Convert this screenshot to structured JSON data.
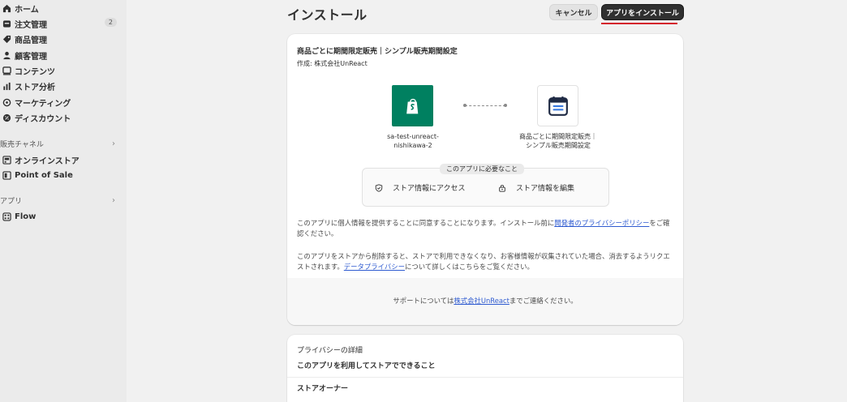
{
  "sidebar": {
    "items": [
      {
        "label": "ホーム",
        "icon": "home-icon"
      },
      {
        "label": "注文管理",
        "icon": "order-icon",
        "badge": "2"
      },
      {
        "label": "商品管理",
        "icon": "tag-icon"
      },
      {
        "label": "顧客管理",
        "icon": "person-icon"
      },
      {
        "label": "コンテンツ",
        "icon": "content-icon"
      },
      {
        "label": "ストア分析",
        "icon": "chart-icon"
      },
      {
        "label": "マーケティング",
        "icon": "target-icon"
      },
      {
        "label": "ディスカウント",
        "icon": "discount-icon"
      }
    ],
    "sales_section": "販売チャネル",
    "sales_items": [
      {
        "label": "オンラインストア",
        "icon": "store-icon"
      },
      {
        "label": "Point of Sale",
        "icon": "pos-icon"
      }
    ],
    "apps_section": "アプリ",
    "app_items": [
      {
        "label": "Flow",
        "icon": "flow-icon"
      }
    ]
  },
  "header": {
    "title": "インストール",
    "cancel_label": "キャンセル",
    "install_label": "アプリをインストール"
  },
  "card": {
    "app_title": "商品ごとに期間限定販売｜シンプル販売期間設定",
    "author": "作成: 株式会社UnReact",
    "store_name_line1": "sa-test-unreact-",
    "store_name_line2": "nishikawa-2",
    "app_name_line1": "商品ごとに期間限定販売｜",
    "app_name_line2": "シンプル販売期間設定",
    "requirements_label": "このアプリに必要なこと",
    "perm_access": "ストア情報にアクセス",
    "perm_edit": "ストア情報を編集",
    "privacy_p1_a": "このアプリに個人情報を提供することに同意することになります。インストール前に",
    "privacy_p1_link": "開発者のプライバシーポリシー",
    "privacy_p1_b": "をご確認ください。",
    "privacy_p2_a": "このアプリをストアから削除すると、ストアで利用できなくなり、お客様情報が収集されていた場合、消去するようリクエストされます。",
    "privacy_p2_link": "データプライバシー",
    "privacy_p2_b": "について詳しくはこちらをご覧ください。",
    "support_a": "サポートについては",
    "support_link": "株式会社UnReact",
    "support_b": "までご連絡ください。"
  },
  "privacy_card": {
    "title": "プライバシーの詳細",
    "subtitle": "このアプリを利用してストアでできること",
    "owner": "ストアオーナー"
  },
  "colors": {
    "accent": "#303030",
    "shopify_green": "#008060",
    "link": "#2f5bd0",
    "highlight_underline": "#d4202c"
  }
}
